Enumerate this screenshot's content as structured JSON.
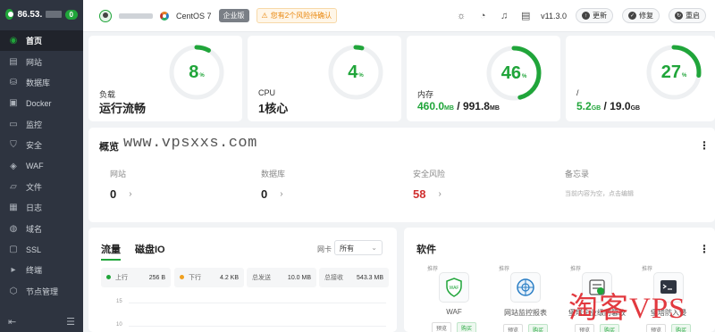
{
  "sidebar": {
    "server_name": "86.53.",
    "badge": "0",
    "items": [
      {
        "label": "首页",
        "icon": "home-icon",
        "glyph": "◉",
        "active": true
      },
      {
        "label": "网站",
        "icon": "website-icon",
        "glyph": "▤"
      },
      {
        "label": "数据库",
        "icon": "database-icon",
        "glyph": "⛁"
      },
      {
        "label": "Docker",
        "icon": "docker-icon",
        "glyph": "▣"
      },
      {
        "label": "监控",
        "icon": "monitor-icon",
        "glyph": "▭"
      },
      {
        "label": "安全",
        "icon": "shield-icon",
        "glyph": "⛉"
      },
      {
        "label": "WAF",
        "icon": "waf-icon",
        "glyph": "◈"
      },
      {
        "label": "文件",
        "icon": "folder-icon",
        "glyph": "▱"
      },
      {
        "label": "日志",
        "icon": "log-icon",
        "glyph": "▦"
      },
      {
        "label": "域名",
        "icon": "globe-icon",
        "glyph": "◍"
      },
      {
        "label": "SSL",
        "icon": "ssl-icon",
        "glyph": "▢"
      },
      {
        "label": "终端",
        "icon": "terminal-icon",
        "glyph": "▸"
      },
      {
        "label": "节点管理",
        "icon": "node-icon",
        "glyph": "⬡"
      }
    ]
  },
  "topbar": {
    "os": "CentOS 7",
    "edition": "企业版",
    "alert": "您有2个风险待确认",
    "version": "v11.3.0",
    "update": "更新",
    "repair": "修复",
    "restart": "重启"
  },
  "stats": {
    "load": {
      "label": "负载",
      "value": "运行流畅",
      "percent": 8
    },
    "cpu": {
      "label": "CPU",
      "value": "1核心",
      "percent": 4
    },
    "memory": {
      "label": "内存",
      "used": "460.0",
      "used_unit": "MB",
      "sep": "/",
      "total": "991.8",
      "total_unit": "MB",
      "percent": 46
    },
    "disk": {
      "label": "/",
      "used": "5.2",
      "used_unit": "GB",
      "sep": "/",
      "total": "19.0",
      "total_unit": "GB",
      "percent": 27
    }
  },
  "overview": {
    "title": "概览",
    "watermark": "www.vpsxxs.com",
    "items": [
      {
        "label": "网站",
        "value": "0"
      },
      {
        "label": "数据库",
        "value": "0"
      },
      {
        "label": "安全风险",
        "value": "58"
      }
    ],
    "memo_label": "备忘录",
    "memo_hint": "当前内容为空，点击编辑"
  },
  "traffic": {
    "tab_traffic": "流量",
    "tab_disk": "磁盘IO",
    "nic_label": "网卡",
    "nic_value": "所有",
    "up_label": "上行",
    "up_value": "256 B",
    "down_label": "下行",
    "down_value": "4.2 KB",
    "total_sent_label": "总发送",
    "total_sent_value": "10.0 MB",
    "total_recv_label": "总接收",
    "total_recv_value": "543.3 MB",
    "yticks": [
      "15",
      "10"
    ]
  },
  "software": {
    "title": "软件",
    "items": [
      {
        "name": "WAF",
        "rec": "推荐",
        "preview": "预览",
        "buy": "购买"
      },
      {
        "name": "网站监控报表",
        "rec": "推荐",
        "preview": "预览",
        "buy": "购买"
      },
      {
        "name": "堡塔企业级防篡改",
        "rec": "推荐",
        "preview": "预览",
        "buy": "购买"
      },
      {
        "name": "堡塔防入侵",
        "rec": "推荐",
        "preview": "预览",
        "buy": "购买"
      }
    ]
  },
  "brand_watermark": "淘客VPS",
  "colors": {
    "accent": "#20a53a",
    "sidebar": "#2e3440",
    "danger": "#d03030"
  }
}
